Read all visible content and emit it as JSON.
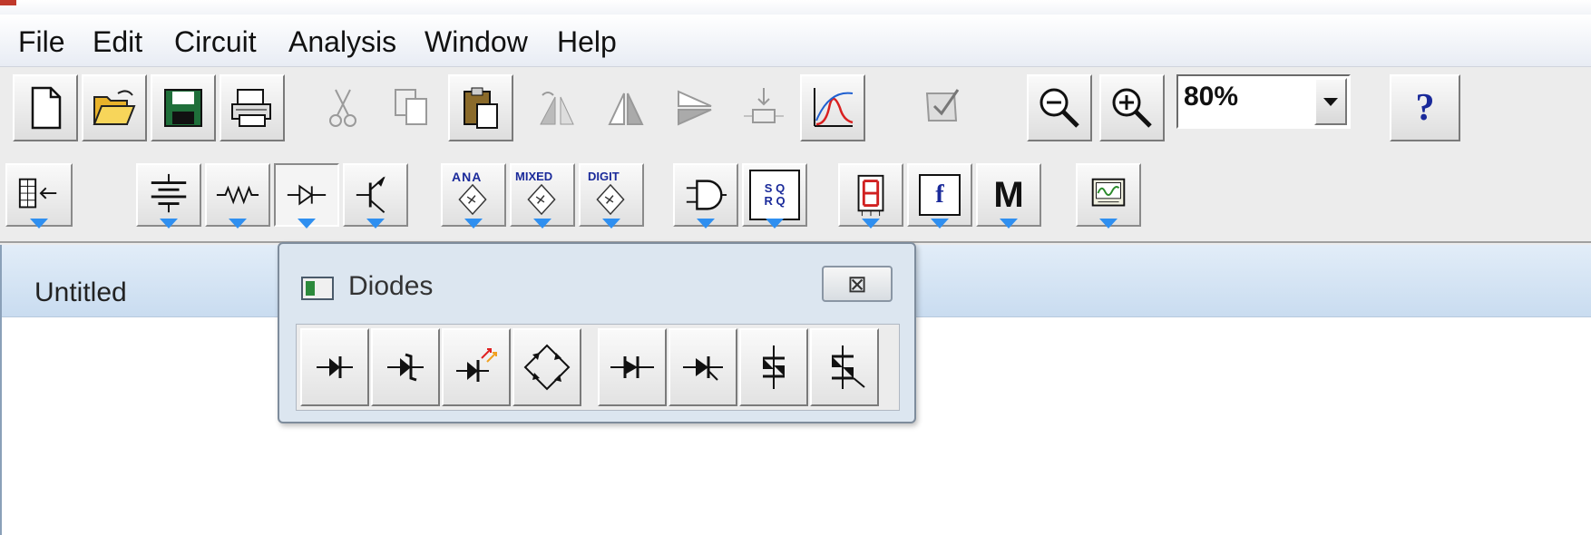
{
  "menubar": {
    "items": [
      "File",
      "Edit",
      "Circuit",
      "Analysis",
      "Window",
      "Help"
    ]
  },
  "toolbar": {
    "zoom_value": "80%",
    "help_label": "?"
  },
  "parts_bin": {
    "ana_label": "ANA",
    "mixed_label": "MIXED",
    "digit_label": "DIGIT",
    "misc_f_label": "f",
    "models_label": "M",
    "sr_label": "S Q R Q"
  },
  "document": {
    "title": "Untitled"
  },
  "diodes_popup": {
    "title": "Diodes",
    "close_label": "⊠"
  },
  "colors": {
    "accent_arrow": "#2f8ff0",
    "titlebar": "#c9dcf0"
  }
}
